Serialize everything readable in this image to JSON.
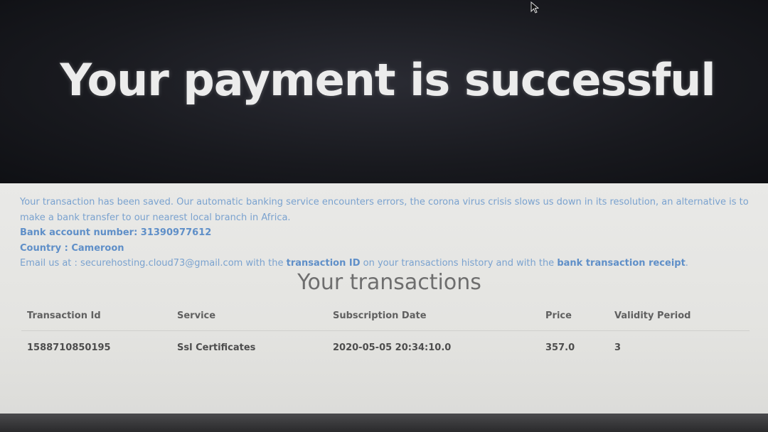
{
  "hero": {
    "title": "Your payment is successful"
  },
  "notice": {
    "message": "Your transaction has been saved. Our automatic banking service encounters errors, the corona virus crisis slows us down in its resolution, an alternative is to make a bank transfer to our nearest local branch in Africa.",
    "bank_account": "Bank account number: 31390977612",
    "country": "Country : Cameroon",
    "email_prefix": "Email us at : securehosting.cloud73@gmail.com with the ",
    "transaction_id_label": "transaction ID",
    "email_middle": " on your transactions history and with the ",
    "receipt_label": "bank transaction receipt",
    "email_suffix": "."
  },
  "transactions": {
    "title": "Your transactions",
    "headers": [
      "Transaction Id",
      "Service",
      "Subscription Date",
      "Price",
      "Validity Period"
    ],
    "rows": [
      {
        "transaction_id": "1588710850195",
        "service": "Ssl Certificates",
        "subscription_date": "2020-05-05 20:34:10.0",
        "price": "357.0",
        "validity_period": "3"
      }
    ]
  },
  "colors": {
    "hero_background": "#18191e",
    "hero_text": "#ececec",
    "panel_background": "#e6e6e3",
    "notice_text": "#7aa2cf",
    "notice_highlight": "#5f8fc8"
  },
  "icons": {
    "cursor": "mouse-pointer-icon"
  }
}
